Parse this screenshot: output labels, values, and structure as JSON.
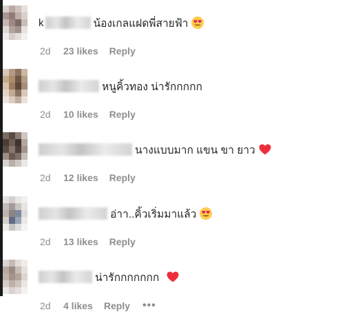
{
  "comments": [
    {
      "text": "น้องเกลแฝดพี่สายฟ้า",
      "emoji": "heart-eyes-emoji",
      "time": "2d",
      "likes": "23 likes",
      "reply": "Reply"
    },
    {
      "text": "หนูคิ้วทอง น่ารักกกกก",
      "emoji": "",
      "time": "2d",
      "likes": "10 likes",
      "reply": "Reply"
    },
    {
      "text": "นางแบบมาก แขน ขา ยาว",
      "emoji": "red-heart-emoji",
      "time": "2d",
      "likes": "12 likes",
      "reply": "Reply"
    },
    {
      "text": "อ่าา..คิ้วเริ่มมาแล้ว",
      "emoji": "heart-eyes-emoji",
      "time": "2d",
      "likes": "13 likes",
      "reply": "Reply"
    },
    {
      "text": "น่ารักกกกกกก",
      "emoji": "red-heart-emoji",
      "time": "2d",
      "likes": "4 likes",
      "reply": "Reply",
      "more": "•••"
    }
  ],
  "colors": {
    "text": "#262626",
    "meta": "#8e8e8e",
    "heart": "#ed2f3b",
    "emoji_face": "#ffcc4d"
  }
}
